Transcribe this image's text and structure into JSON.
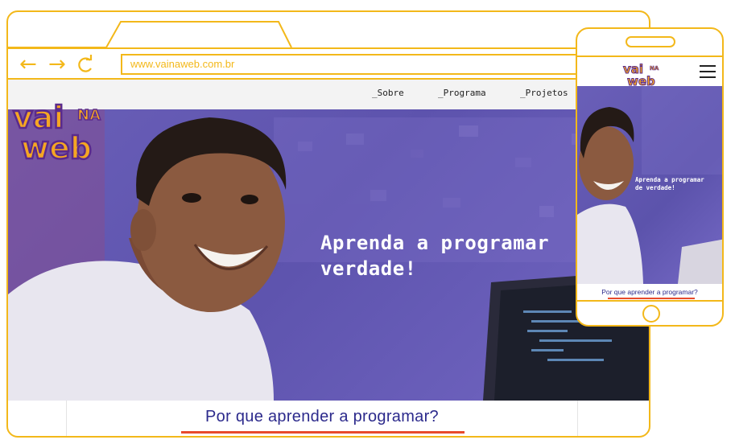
{
  "browser": {
    "address_url": "www.vainaweb.com.br",
    "back_icon": "arrow-left-icon",
    "forward_icon": "arrow-right-icon",
    "reload_icon": "reload-icon"
  },
  "site": {
    "logo_text": [
      "vai",
      "NA",
      "web"
    ],
    "nav": [
      {
        "label": "_Sobre"
      },
      {
        "label": "_Programa"
      },
      {
        "label": "_Projetos"
      }
    ],
    "hero_headline": "Aprenda a programar\nverdade!",
    "cta_label": "Por que aprender a programar?"
  },
  "mobile": {
    "logo_text": [
      "vai",
      "NA",
      "web"
    ],
    "menu_icon": "hamburger-icon",
    "hero_headline": "Aprenda a programar\nde verdade!",
    "cta_label": "Por que aprender a programar?"
  },
  "colors": {
    "frame": "#f3b81a",
    "hero_overlay": "#5d53ad",
    "cta_text": "#2c2a8c",
    "cta_underline": "#e84a2c",
    "logo_orange": "#f5a623",
    "logo_purple": "#5a2a8c"
  }
}
